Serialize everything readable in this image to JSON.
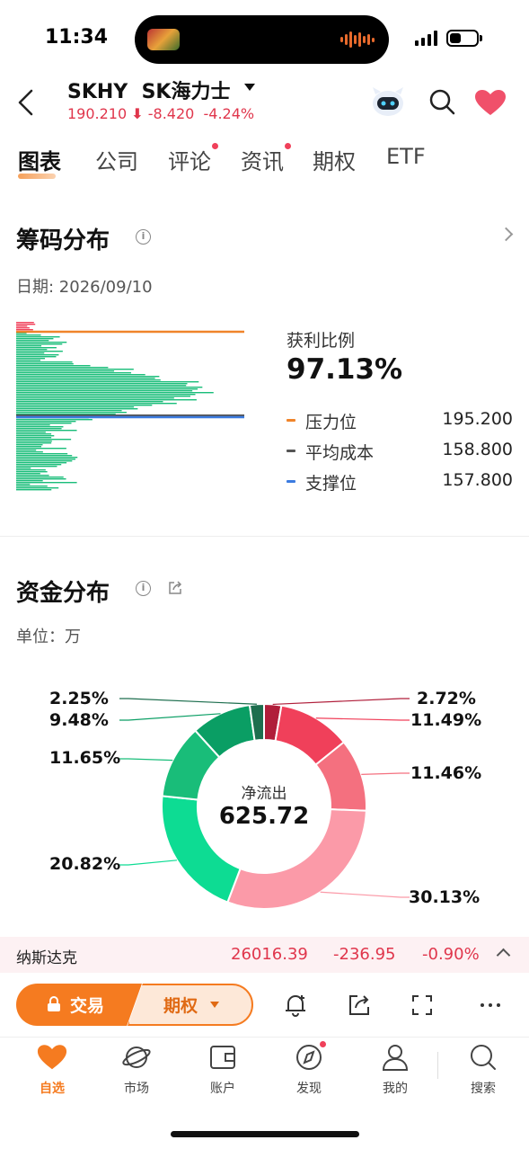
{
  "status_bar": {
    "time": "11:34"
  },
  "header": {
    "ticker": "SKHY",
    "name": "SK海力士",
    "price": "190.210",
    "change": "-8.420",
    "change_pct": "-4.24%",
    "colors": {
      "down": "#e0364c",
      "accent": "#f57b20"
    }
  },
  "tabs": [
    {
      "label": "图表",
      "active": true,
      "dot": false
    },
    {
      "label": "公司",
      "active": false,
      "dot": false
    },
    {
      "label": "评论",
      "active": false,
      "dot": true
    },
    {
      "label": "资讯",
      "active": false,
      "dot": true
    },
    {
      "label": "期权",
      "active": false,
      "dot": false
    },
    {
      "label": "ETF",
      "active": false,
      "dot": false
    }
  ],
  "chips": {
    "title": "筹码分布",
    "date": "日期: 2026/09/10",
    "profit_label": "获利比例",
    "profit_value": "97.13%",
    "levels": [
      {
        "name": "压力位",
        "value": "195.200",
        "color": "#f0842a"
      },
      {
        "name": "平均成本",
        "value": "158.800",
        "color": "#555555"
      },
      {
        "name": "支撑位",
        "value": "157.800",
        "color": "#3b7be0"
      }
    ]
  },
  "funds": {
    "title": "资金分布",
    "unit": "单位：万",
    "center_label": "净流出",
    "center_value": "625.72",
    "segments": [
      {
        "pct": "2.72%",
        "value": 2.72,
        "color": "#b01e3a"
      },
      {
        "pct": "11.49%",
        "value": 11.49,
        "color": "#f0405a"
      },
      {
        "pct": "11.46%",
        "value": 11.46,
        "color": "#f4707f"
      },
      {
        "pct": "30.13%",
        "value": 30.13,
        "color": "#fb9aa8"
      },
      {
        "pct": "20.82%",
        "value": 20.82,
        "color": "#0ddc93"
      },
      {
        "pct": "11.65%",
        "value": 11.65,
        "color": "#19bd79"
      },
      {
        "pct": "9.48%",
        "value": 9.48,
        "color": "#0a9e64"
      },
      {
        "pct": "2.25%",
        "value": 2.25,
        "color": "#1d6e4e"
      }
    ]
  },
  "index_bar": {
    "name": "纳斯达克",
    "price": "26016.39",
    "change": "-236.95",
    "change_pct": "-0.90%"
  },
  "actions": {
    "trade": "交易",
    "options": "期权",
    "icons": [
      "bell-plus-icon",
      "share-icon",
      "fullscreen-icon",
      "more-icon"
    ]
  },
  "bottom_nav": [
    {
      "label": "自选",
      "icon": "heart-icon",
      "active": true
    },
    {
      "label": "市场",
      "icon": "planet-icon",
      "active": false
    },
    {
      "label": "账户",
      "icon": "wallet-icon",
      "active": false
    },
    {
      "label": "发现",
      "icon": "compass-icon",
      "active": false,
      "dot": true
    },
    {
      "label": "我的",
      "icon": "person-icon",
      "active": false
    },
    {
      "label": "搜索",
      "icon": "search-icon",
      "active": false
    }
  ]
}
